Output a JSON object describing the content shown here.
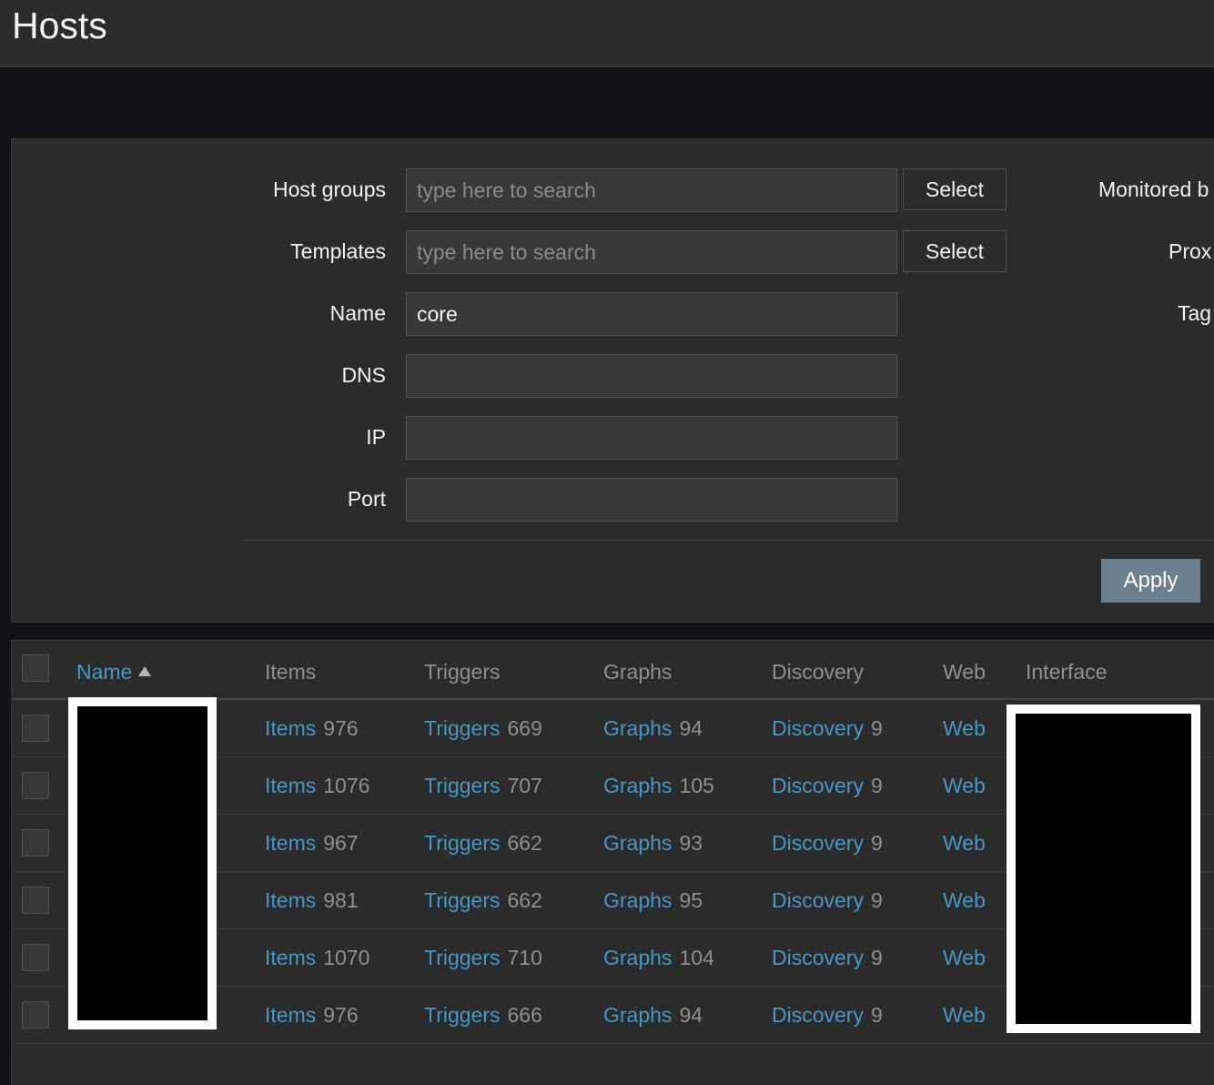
{
  "header": {
    "title": "Hosts"
  },
  "filter": {
    "host_groups": {
      "label": "Host groups",
      "placeholder": "type here to search",
      "button": "Select"
    },
    "templates": {
      "label": "Templates",
      "placeholder": "type here to search",
      "button": "Select"
    },
    "name": {
      "label": "Name",
      "value": "core"
    },
    "dns": {
      "label": "DNS",
      "value": ""
    },
    "ip": {
      "label": "IP",
      "value": ""
    },
    "port": {
      "label": "Port",
      "value": ""
    },
    "right_labels": {
      "monitored_by": "Monitored b",
      "proxy": "Prox",
      "tags": "Tag"
    },
    "apply": "Apply"
  },
  "table": {
    "columns": {
      "name": "Name",
      "items": "Items",
      "triggers": "Triggers",
      "graphs": "Graphs",
      "discovery": "Discovery",
      "web": "Web",
      "interface": "Interface"
    },
    "rows": [
      {
        "items_label": "Items",
        "items": "976",
        "triggers_label": "Triggers",
        "triggers": "669",
        "graphs_label": "Graphs",
        "graphs": "94",
        "discovery_label": "Discovery",
        "discovery": "9",
        "web": "Web"
      },
      {
        "items_label": "Items",
        "items": "1076",
        "triggers_label": "Triggers",
        "triggers": "707",
        "graphs_label": "Graphs",
        "graphs": "105",
        "discovery_label": "Discovery",
        "discovery": "9",
        "web": "Web"
      },
      {
        "items_label": "Items",
        "items": "967",
        "triggers_label": "Triggers",
        "triggers": "662",
        "graphs_label": "Graphs",
        "graphs": "93",
        "discovery_label": "Discovery",
        "discovery": "9",
        "web": "Web"
      },
      {
        "items_label": "Items",
        "items": "981",
        "triggers_label": "Triggers",
        "triggers": "662",
        "graphs_label": "Graphs",
        "graphs": "95",
        "discovery_label": "Discovery",
        "discovery": "9",
        "web": "Web"
      },
      {
        "items_label": "Items",
        "items": "1070",
        "triggers_label": "Triggers",
        "triggers": "710",
        "graphs_label": "Graphs",
        "graphs": "104",
        "discovery_label": "Discovery",
        "discovery": "9",
        "web": "Web"
      },
      {
        "items_label": "Items",
        "items": "976",
        "triggers_label": "Triggers",
        "triggers": "666",
        "graphs_label": "Graphs",
        "graphs": "94",
        "discovery_label": "Discovery",
        "discovery": "9",
        "web": "Web"
      }
    ]
  },
  "colors": {
    "link": "#4796c4",
    "muted": "#8f8f8f",
    "panel": "#2b2b2b",
    "background": "#121316",
    "apply_button": "#6b7f8d"
  }
}
